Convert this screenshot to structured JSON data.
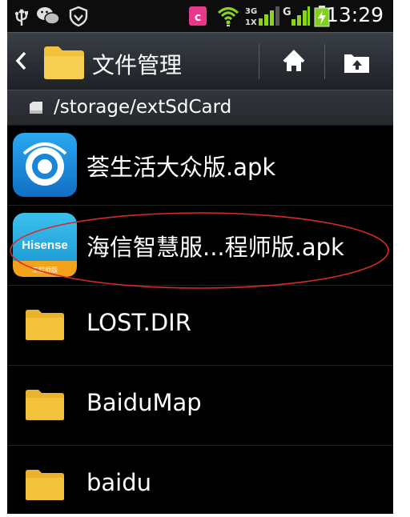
{
  "status_bar": {
    "time": "13:29",
    "left_icons": [
      "usb-icon",
      "wechat-icon",
      "shield-icon"
    ],
    "right_icons": [
      "app-notification-icon",
      "wifi-icon",
      "3g-signal-icon",
      "g-signal-icon",
      "battery-charging-icon"
    ],
    "network_3g": "3G",
    "network_g": "G",
    "colors": {
      "notification": "#e8388c",
      "wifi": "#8bd41c",
      "battery": "#7fd11b"
    }
  },
  "action_bar": {
    "title": "文件管理",
    "buttons": [
      "home-icon",
      "up-folder-icon"
    ]
  },
  "path_bar": {
    "path": "/storage/extSdCard"
  },
  "files": [
    {
      "name": "荟生活大众版.apk",
      "type": "apk",
      "icon": "huishenghuo-app-icon"
    },
    {
      "name": "海信智慧服...程师版.apk",
      "type": "apk",
      "icon": "hisense-app-icon",
      "icon_label": "Hisense",
      "icon_sublabel": "工程师版",
      "highlighted": true
    },
    {
      "name": "LOST.DIR",
      "type": "folder",
      "icon": "folder-icon"
    },
    {
      "name": "BaiduMap",
      "type": "folder",
      "icon": "folder-icon"
    },
    {
      "name": "baidu",
      "type": "folder",
      "icon": "folder-icon"
    }
  ],
  "colors": {
    "folder": "#f2c23b",
    "annotation": "#d82a2a",
    "background": "#000000"
  }
}
